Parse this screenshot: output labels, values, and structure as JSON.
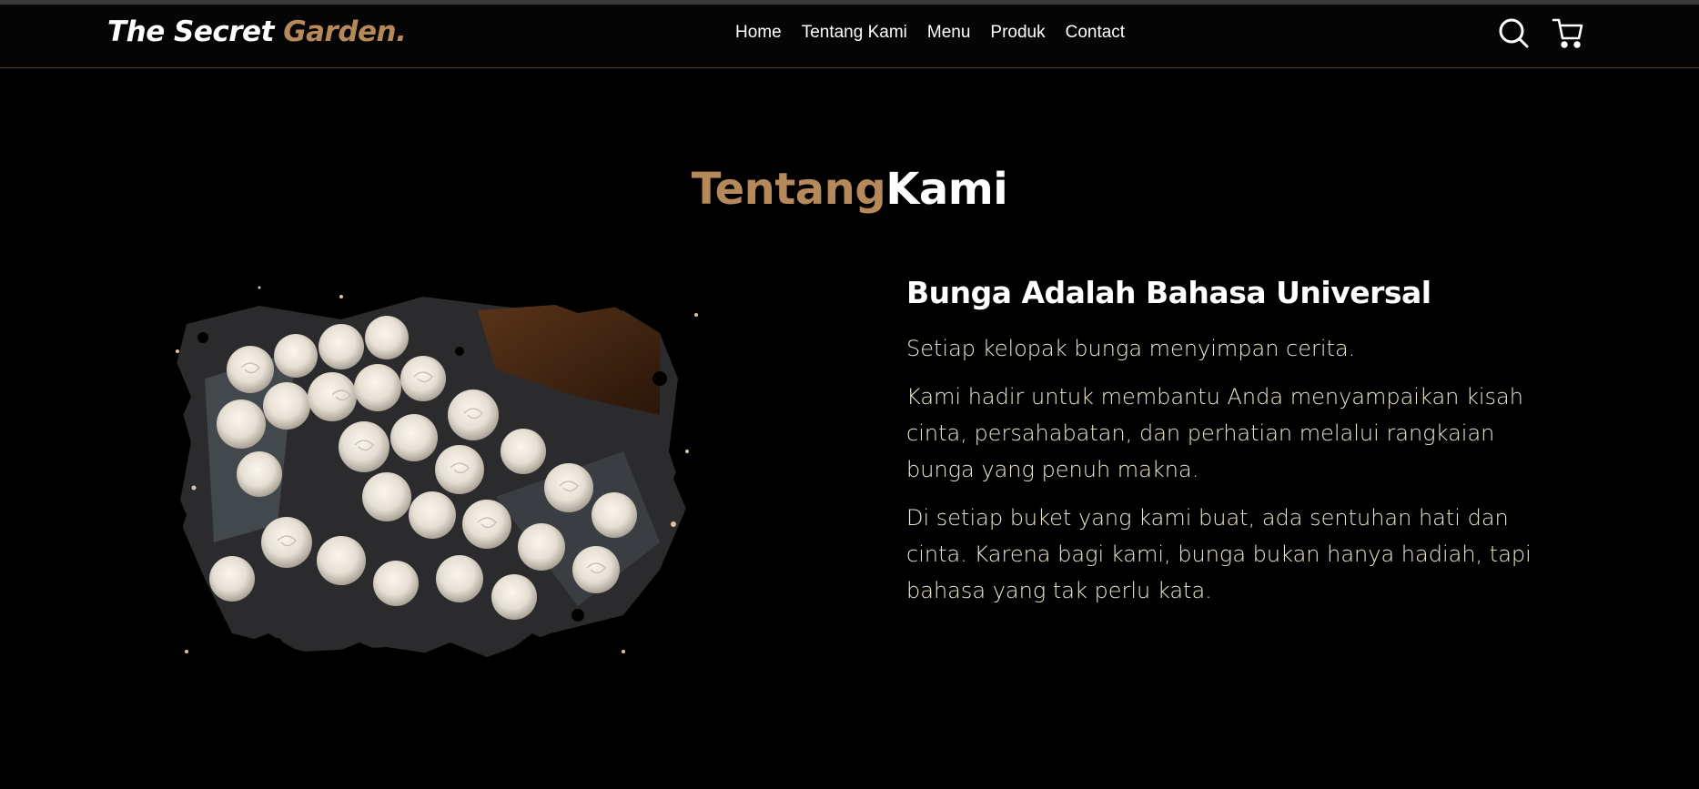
{
  "brand": {
    "name_main": "The Secret ",
    "name_accent": "Garden."
  },
  "nav": {
    "items": [
      "Home",
      "Tentang Kami",
      "Menu",
      "Produk",
      "Contact"
    ]
  },
  "icons": {
    "search": "search-icon",
    "cart": "cart-icon"
  },
  "about": {
    "title_accent": "Tentang",
    "title_main": "Kami",
    "heading": "Bunga Adalah Bahasa Universal",
    "paragraphs": [
      "Setiap kelopak bunga menyimpan cerita.",
      "Kami hadir untuk membantu Anda menyampaikan kisah cinta, persahabatan, dan perhatian melalui rangkaian bunga yang penuh makna.",
      "Di setiap buket yang kami buat, ada sentuhan hati dan cinta. Karena bagi kami, bunga bukan hanya hadiah, tapi bahasa yang tak perlu kata."
    ]
  },
  "colors": {
    "accent": "#b6895b",
    "background": "#000000",
    "text": "#ffffff"
  }
}
